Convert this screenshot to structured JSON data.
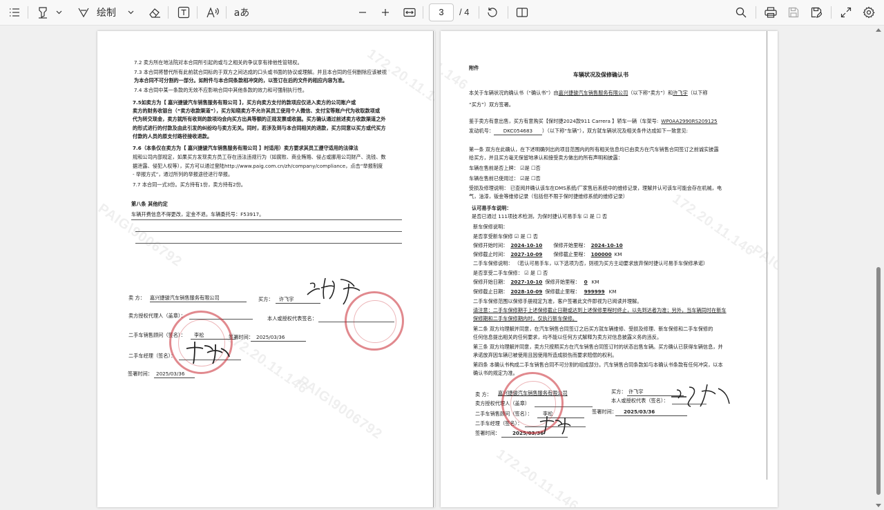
{
  "toolbar": {
    "draw_label": "绘制",
    "text_format_label": "aあ",
    "current_page": "3",
    "total_pages": "/ 4"
  },
  "page1": {
    "lines": [
      "7.2  卖方所在地法院对本合同所引起的或与之相关的争议享有排他性管辖权。",
      "7.3  本合同将替代所有此前就合同标的于双方之间达成的口头或书面的协议或理解。并且本合同的任何删除应该被视",
      "为本合同不可分割的一部分。如附件与本合同条款相冲突的，以签订在后的文件的相应内容为准。",
      "7.4  本合同中某一条款的无效不应影响合同中其他条款的效力和可强制执行性。",
      "7.5如卖方为【        嘉兴捷骏汽车销售服务有限公司          】，买方向卖方支付的款项应仅进入卖方的公司账户或",
      "卖方的财务收银台（“卖方收款渠道”），买方知晓卖方不允许其员工使用个人微信、支付宝等账户代为收取款项或",
      "代为转交现金，卖方就所有收到的款项均会向买方出具等额的正规发票或收据。买方确认通过前述卖方收款渠道之外",
      "的形式进行的付款及由此引发的纠纷均与卖方无关。同时，若涉及到与本合同相关的退款，买方同意以买方或代买方",
      "付款的人员的原支付路径接收退款。",
      "7.6（本条仅在卖方为【         嘉兴捷骏汽车销售服务有限公司         】时适用）卖方要求其员工遵守适用的法律法",
      "规和公司内部规定，如果买方发现卖方员工存在违法违规行为（如腐败、商业贿赂、侵占或挪用公司财产、洗钱、数",
      "据泄露、侵犯人权等），买方可以通过登陆http://www.paig.com.cn/zh/company/compliance，点击“举报制度",
      "- 举报方式”，通过所列的举报途径进行举报。",
      "7.7  本合同一式3份。买方持有1份，卖方持有2份。"
    ],
    "section8_title": "第八条  其他约定",
    "section8_text": "车辆开费信息不得更改，定金不退。车辆委托号：F53917。",
    "seller_label": "卖  方：",
    "seller_name": "嘉兴捷骏汽车销售服务有限公司",
    "buyer_label": "买方：",
    "buyer_name": "许飞宇",
    "seller_agent": "卖方授权代理人（盖章）：",
    "buyer_rep": "本人或授权代表签名：",
    "advisor_label": "二手车销售顾问（签名）：",
    "advisor_name": "李松",
    "sign_date_label": "签署时间：",
    "sign_date": "2025/03/36",
    "manager_label": "二手车经理（签名）：",
    "bottom_date_label": "签署时间：",
    "bottom_date": "2025/03/36"
  },
  "page2": {
    "attachment": "附件",
    "title": "车辆状况及保修确认书",
    "intro1": "本关于车辆状况的确认书（“确认书”）由",
    "intro_company": "嘉兴捷骏汽车销售服务有限公司",
    "intro2": "（以下称“卖方”）和",
    "intro_buyer": "许飞宇",
    "intro3": "（以下称",
    "intro4": "“买方”）双方签署。",
    "purchase1": "鉴于卖方有意出售，买方有意购买【保时捷2024款911 Carrera 】轿车一辆（车架号:",
    "vin": "WP0AA2990RS209125",
    "purchase2": "发动机号：",
    "engine": "DKC054683",
    "purchase3": "）（以下称“车辆”），双方就车辆状况及相关条件达成如下一致意见:",
    "art1a": "第一条  双方在此确认，在下述明确列出的项目范围内的所有相关信息均已由卖方在汽车销售合同签订之前诚实披露",
    "art1b": "给买方，并且买方毫无保留地承认和接受卖方做出的所有声明和披露：",
    "listed": "车辆在售前是否上牌：     ☑是         ☐否",
    "used": "车辆在售前已使用过：     ☑是         ☐否",
    "repair1": "受损及修理说明：  已查阅并确认该车在DMS系统/厂家售后系统中的维修记录，理解并认可该车可能会存在机械，电",
    "repair2": "气，油漆，钣金等维修记录（包括但不限于保时捷维修系统的维修记录）",
    "certified_title": "认可易手车说明：",
    "certified_q": "是否已通过  111项技术检测，为保时捷认可易手车  ☑ 是   ☐ 否",
    "new_warranty": "新车保修说明：",
    "new_warranty_q": "是否享受新车保修    ☑ 是   ☐ 否",
    "nw_start_label": "保修开始时间：",
    "nw_start": "2024-10-10",
    "nw_start_km_label": "保修开始里程：",
    "nw_start_km": "0",
    "nw_end_label": "保修截止时间：",
    "nw_end": "2027-10-09",
    "nw_end_km_label": "保修截止里程：",
    "nw_end_km": "100000",
    "km": "KM",
    "used_warranty": "二手车保修说明：  （若认可易手车，以下选项为否，则视为买方主动要求放弃保时捷认可易手车保修承诺）",
    "used_warranty_q": "是否享受二手车保修：  ☑ 是    ☐ 否",
    "uw_start_label": "保修开始日期：",
    "uw_start": "2027-10-10",
    "uw_start_km_label": "保修开始里程：",
    "uw_start_km": "0",
    "uw_end_label": "保修截止日期：",
    "uw_end": "2028-10-09",
    "uw_end_km_label": "保修截止里程：",
    "uw_end_km": "999999",
    "scope1": "二手车保修范围以保修手册规定为准，客户签署此文件即视为已阅读并理解。",
    "scope2": "请注意：二手车保修期于上述保修截止日期或达到上述保修里程时终止，以先到达者为准；另外，当车辆同时在新车",
    "scope3": "保修期和二手车保修期内时，仅执行新车保修。",
    "art2a": "第二条  双方均理解并同意，在汽车销售合同签订之后买方就车辆维修、受损及修理、新车保修和二手车保修的",
    "art2b": "任何信息提出相关的任何要求，均不能以任何方式解释为卖方对信息披露义务的违反。",
    "art3a": "第三条  双方均理解并同意，卖方只按照买方在汽车销售合同签订时的状态出售车辆。买方确认已获得车辆信息，并",
    "art3b": "承诺放弃因车辆已被使用且因使用所造成损伤而要求赔偿的权利。",
    "art4a": "第四条  本确认书构成二手车销售合同不可分割的组成部分。汽车销售合同条款如与本确认书条款有任何冲突，以本",
    "art4b": "确认书的规定为准。",
    "seller_label": "卖  方：",
    "seller_name": "嘉兴捷骏汽车销售服务有限公司",
    "buyer_label": "买方：",
    "buyer_name": "许飞宇",
    "seller_agent": "卖方授权代理人（盖章）",
    "buyer_rep": "本人或授权代表（签名）：",
    "advisor_label": "二手车销售顾问（签名）：",
    "advisor_name": "李松",
    "sign_date_label": "签署时间：",
    "sign_date": "2025/03/36",
    "manager_label": "二手车经理（签名）：",
    "bottom_date_label": "签署时间：",
    "bottom_date": "2025/03/36"
  },
  "watermark": {
    "ip": "172.20.11.146",
    "tag": "PAIG\\9006792"
  }
}
